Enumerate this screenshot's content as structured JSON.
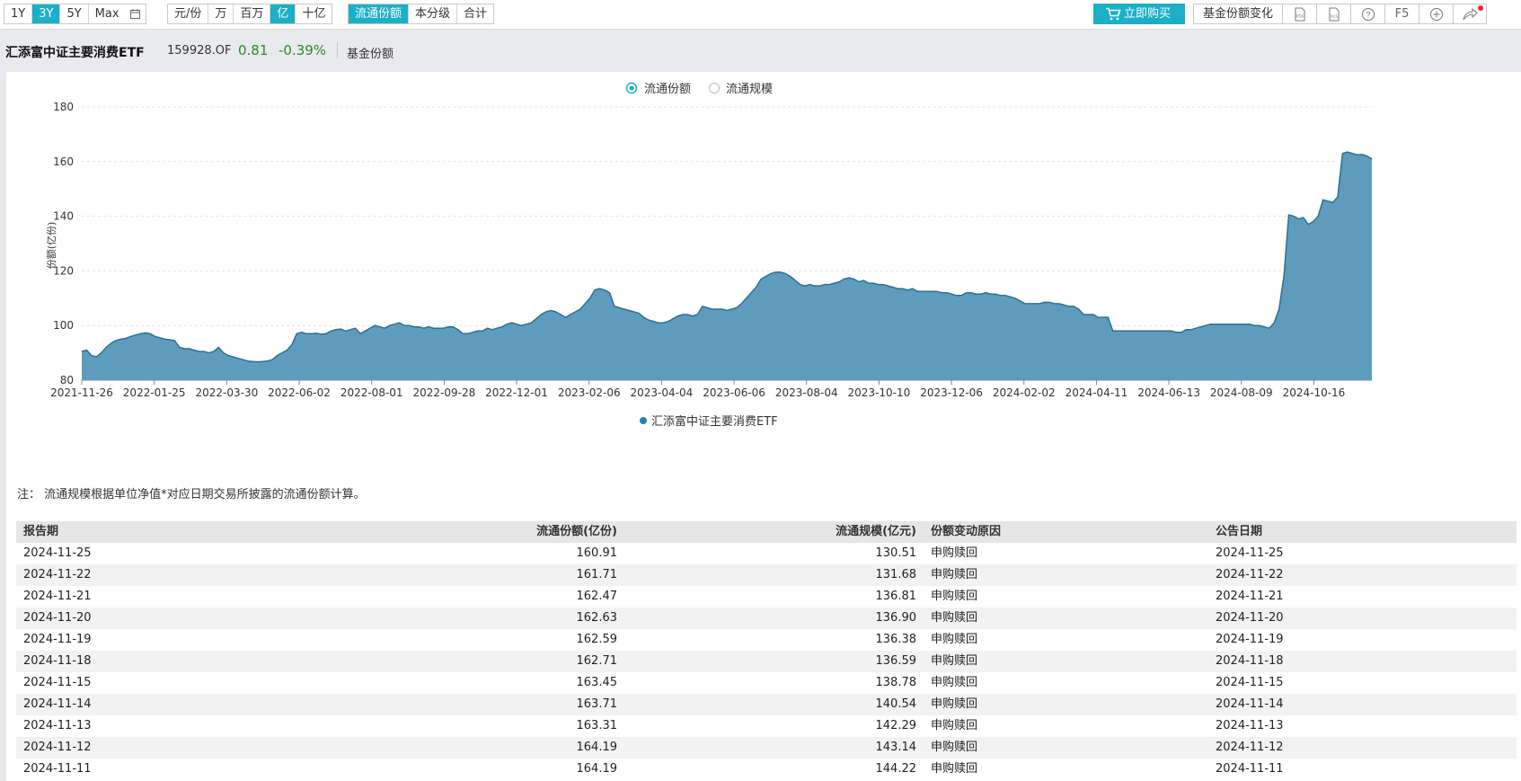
{
  "toolbar": {
    "period_buttons": [
      "1Y",
      "3Y",
      "5Y",
      "Max"
    ],
    "active_period": "3Y",
    "unit_buttons": [
      "元/份",
      "万",
      "百万",
      "亿",
      "十亿"
    ],
    "active_unit": "亿",
    "view_buttons": [
      "流通份额",
      "本分级",
      "合计"
    ],
    "active_view": "流通份额",
    "buy_label": "立即购买",
    "share_change_label": "基金份额变化",
    "pdf_label": "PDF",
    "xls_label": "XLS",
    "f5_label": "F5"
  },
  "fund": {
    "name": "汇添富中证主要消费ETF",
    "code": "159928.OF",
    "nav": "0.81",
    "change": "-0.39%",
    "tag": "基金份额"
  },
  "legend_top": {
    "option_selected": "流通份额",
    "option_other": "流通规模"
  },
  "colors": {
    "accent": "#1ab0c8",
    "area_fill": "#5e9cbd",
    "area_line": "#2d6f93",
    "positive_green": "#2a8c2a"
  },
  "chart_data": {
    "type": "area",
    "ylabel": "份额(亿份)",
    "ylim": [
      80,
      180
    ],
    "yticks": [
      80,
      100,
      120,
      140,
      160,
      180
    ],
    "xticks": [
      "2021-11-26",
      "2022-01-25",
      "2022-03-30",
      "2022-06-02",
      "2022-08-01",
      "2022-09-28",
      "2022-12-01",
      "2023-02-06",
      "2023-04-04",
      "2023-06-06",
      "2023-08-04",
      "2023-10-10",
      "2023-12-06",
      "2024-02-02",
      "2024-04-11",
      "2024-06-13",
      "2024-08-09",
      "2024-10-16"
    ],
    "series": [
      {
        "name": "汇添富中证主要消费ETF",
        "values": [
          90.5,
          91,
          89,
          88.5,
          90,
          92,
          93.5,
          94.5,
          95,
          95.3,
          96,
          96.5,
          97,
          97.3,
          97,
          96,
          95.5,
          95,
          94.8,
          94.5,
          92,
          91.5,
          91.5,
          91,
          90.5,
          90.5,
          90,
          90.5,
          92,
          90,
          89,
          88.5,
          88,
          87.5,
          87,
          86.8,
          86.7,
          86.8,
          87,
          87.5,
          89,
          90,
          91,
          93,
          97,
          97.5,
          97,
          97,
          97.2,
          96.8,
          97,
          98,
          98.5,
          98.7,
          98,
          98.5,
          99,
          97,
          98,
          99,
          100,
          99.5,
          99,
          100,
          100.5,
          101,
          100,
          100,
          99.5,
          99.5,
          99,
          99.5,
          99,
          99,
          99,
          99.5,
          99.5,
          98.5,
          97,
          97,
          97.5,
          98,
          98,
          99,
          98.5,
          99,
          99.5,
          100.5,
          101,
          100.5,
          100,
          100.5,
          101,
          102.5,
          104,
          105,
          105.5,
          105,
          104,
          103,
          104,
          105,
          106,
          108,
          110,
          113,
          113.5,
          113,
          112,
          107,
          106.5,
          106,
          105.5,
          105,
          104.5,
          103,
          102,
          101.5,
          101,
          101,
          101.5,
          102.5,
          103.5,
          104,
          104,
          103.5,
          104,
          107,
          106.5,
          106,
          106,
          106,
          105.5,
          106,
          106.5,
          108,
          110,
          112,
          114,
          117,
          118,
          119,
          119.5,
          119.5,
          119,
          118,
          116.5,
          115,
          114.5,
          115,
          114.5,
          114.5,
          115,
          115,
          115.5,
          116,
          117,
          117.5,
          117,
          116,
          116.5,
          115.5,
          115.5,
          115,
          115,
          114.5,
          114,
          113.5,
          113.5,
          113,
          113.5,
          112.5,
          112.5,
          112.5,
          112.5,
          112.5,
          112,
          112,
          111.5,
          111,
          111,
          112,
          112,
          111.5,
          111.5,
          112,
          111.5,
          111.5,
          111,
          111,
          110.5,
          110,
          109,
          108,
          108,
          108,
          108,
          108.5,
          108.5,
          108,
          108,
          107.5,
          107,
          107,
          106,
          104,
          104,
          104,
          103,
          103,
          103,
          98,
          98,
          98,
          98,
          98,
          98,
          98,
          98,
          98,
          98,
          98,
          98,
          98,
          97.5,
          97.5,
          98.5,
          98.5,
          99,
          99.5,
          100,
          100.5,
          100.5,
          100.5,
          100.5,
          100.5,
          100.5,
          100.5,
          100.5,
          100.5,
          100,
          100,
          99.5,
          99,
          101,
          106,
          118,
          140.5,
          140,
          139,
          139.5,
          137,
          138,
          140,
          146,
          145.5,
          145,
          147,
          163,
          163.5,
          163,
          162.5,
          162.6,
          162,
          161
        ]
      }
    ],
    "grid": true,
    "legend": "bottom-center"
  },
  "note": "注：  流通规模根据单位净值*对应日期交易所披露的流通份额计算。",
  "table": {
    "headers": [
      "报告期",
      "流通份额(亿份)",
      "流通规模(亿元)",
      "份额变动原因",
      "公告日期"
    ],
    "rows": [
      [
        "2024-11-25",
        "160.91",
        "130.51",
        "申购赎回",
        "2024-11-25"
      ],
      [
        "2024-11-22",
        "161.71",
        "131.68",
        "申购赎回",
        "2024-11-22"
      ],
      [
        "2024-11-21",
        "162.47",
        "136.81",
        "申购赎回",
        "2024-11-21"
      ],
      [
        "2024-11-20",
        "162.63",
        "136.90",
        "申购赎回",
        "2024-11-20"
      ],
      [
        "2024-11-19",
        "162.59",
        "136.38",
        "申购赎回",
        "2024-11-19"
      ],
      [
        "2024-11-18",
        "162.71",
        "136.59",
        "申购赎回",
        "2024-11-18"
      ],
      [
        "2024-11-15",
        "163.45",
        "138.78",
        "申购赎回",
        "2024-11-15"
      ],
      [
        "2024-11-14",
        "163.71",
        "140.54",
        "申购赎回",
        "2024-11-14"
      ],
      [
        "2024-11-13",
        "163.31",
        "142.29",
        "申购赎回",
        "2024-11-13"
      ],
      [
        "2024-11-12",
        "164.19",
        "143.14",
        "申购赎回",
        "2024-11-12"
      ],
      [
        "2024-11-11",
        "164.19",
        "144.22",
        "申购赎回",
        "2024-11-11"
      ]
    ]
  }
}
